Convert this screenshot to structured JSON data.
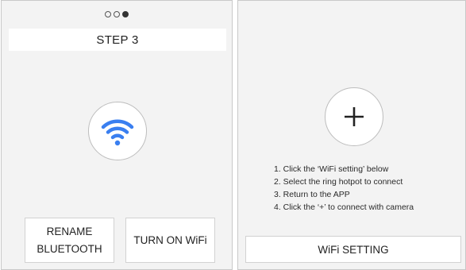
{
  "left_panel": {
    "progress": {
      "total_steps": 3,
      "current_step": 3
    },
    "step_title": "STEP 3",
    "wifi_icon": "wifi-icon",
    "buttons": {
      "rename_line1": "RENAME",
      "rename_line2": "BLUETOOTH",
      "turn_on": "TURN ON WiFi"
    }
  },
  "right_panel": {
    "add_icon": "plus-icon",
    "instructions": [
      "1. Click the ‘WiFi setting’ below",
      "2. Select the ring hotpot to connect",
      "3. Return to the APP",
      "4. Click the ‘+’ to connect with camera"
    ],
    "wifi_setting_button": "WiFi SETTING"
  },
  "colors": {
    "panel_bg": "#f3f3f3",
    "wifi_blue": "#3a7ff0",
    "border": "#c9c9c9"
  }
}
